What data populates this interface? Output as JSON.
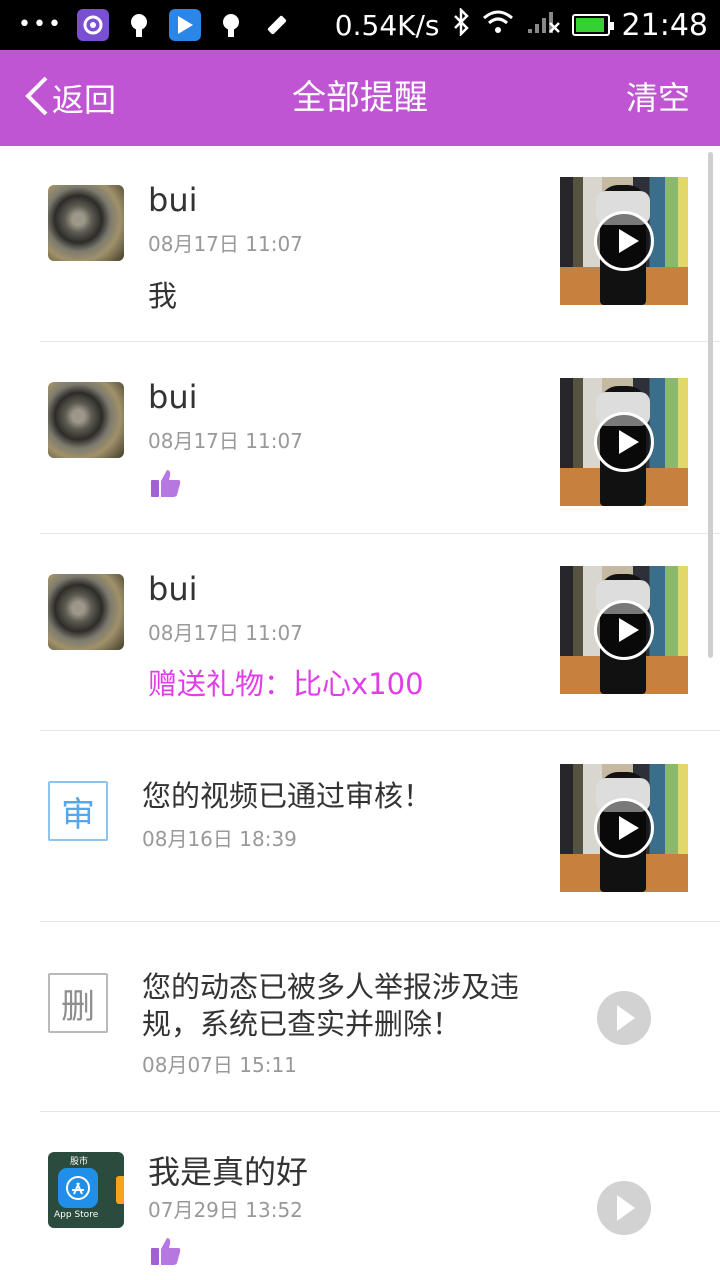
{
  "status_bar": {
    "dots": "•••",
    "net_speed": "0.54K/s",
    "time": "21:48",
    "icons": [
      "app-purple-icon",
      "notification-icon",
      "play-store-icon",
      "notification-icon",
      "tools-icon",
      "bluetooth-icon",
      "wifi-icon",
      "signal-icon",
      "battery-icon"
    ]
  },
  "header": {
    "back_label": "返回",
    "title": "全部提醒",
    "clear_label": "清空",
    "background": "#bf55d2"
  },
  "notifications": [
    {
      "type": "comment",
      "user": "bui",
      "time": "08月17日 11:07",
      "content": "我"
    },
    {
      "type": "like",
      "user": "bui",
      "time": "08月17日 11:07",
      "icon": "thumbs-up-icon"
    },
    {
      "type": "gift",
      "user": "bui",
      "time": "08月17日 11:07",
      "content": "赠送礼物：比心x100",
      "color": "#e13ee8"
    },
    {
      "type": "system",
      "badge": "审",
      "text": "您的视频已通过审核！",
      "time": "08月16日 18:39"
    },
    {
      "type": "system",
      "badge": "删",
      "text": "您的动态已被多人举报涉及违规，系统已查实并删除！",
      "time": "08月07日 15:11"
    },
    {
      "type": "like",
      "user": "我是真的好",
      "time": "07月29日 13:52",
      "icon": "thumbs-up-icon",
      "avatar_caption_top": "股市",
      "avatar_caption": "App Store"
    }
  ]
}
